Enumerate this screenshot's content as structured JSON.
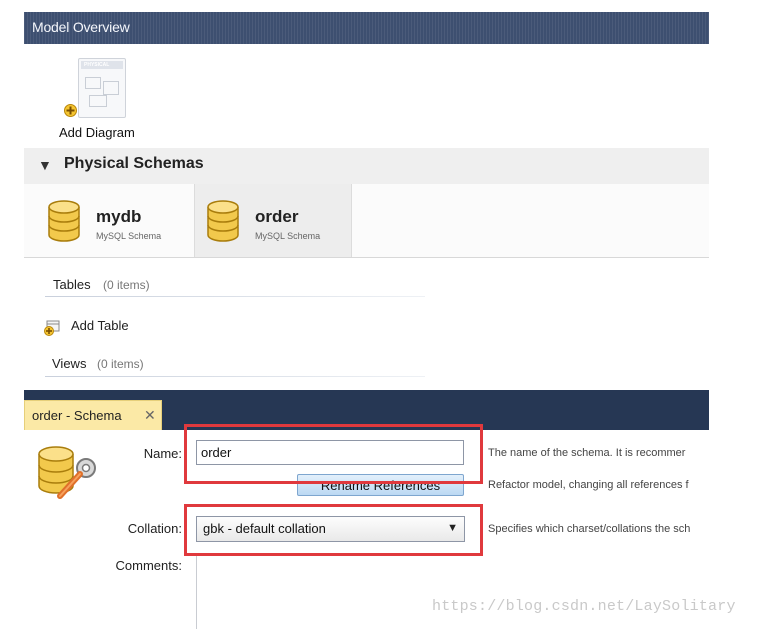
{
  "model_overview": {
    "title": "Model Overview"
  },
  "diagram": {
    "add_label": "Add Diagram",
    "thumbnail_label": "PHYSICAL"
  },
  "physical_schemas": {
    "title": "Physical Schemas",
    "schemas": [
      {
        "name": "mydb",
        "subtitle": "MySQL Schema"
      },
      {
        "name": "order",
        "subtitle": "MySQL Schema"
      }
    ]
  },
  "tables": {
    "label": "Tables",
    "count": "(0 items)",
    "add_label": "Add Table"
  },
  "views": {
    "label": "Views",
    "count": "(0 items)"
  },
  "editor": {
    "tab_label": "order - Schema",
    "close_glyph": "✕",
    "name_label": "Name:",
    "name_value": "order",
    "name_desc": "The name of the schema. It is recommer",
    "rename_button": "Rename References",
    "rename_desc": "Refactor model, changing all references f",
    "collation_label": "Collation:",
    "collation_value": "gbk - default collation",
    "collation_desc": "Specifies which charset/collations the sch",
    "comments_label": "Comments:"
  },
  "watermark": "https://blog.csdn.net/LaySolitary",
  "colors": {
    "header_bg": "#3d4f70",
    "editor_bar_bg": "#263754",
    "active_tab_bg": "#fbe9a6",
    "highlight": "#e0393d",
    "db_icon": "#f2c94c"
  },
  "icons": [
    "add-icon",
    "database-icon",
    "schema-settings-icon",
    "chevron-down-icon",
    "close-icon"
  ]
}
